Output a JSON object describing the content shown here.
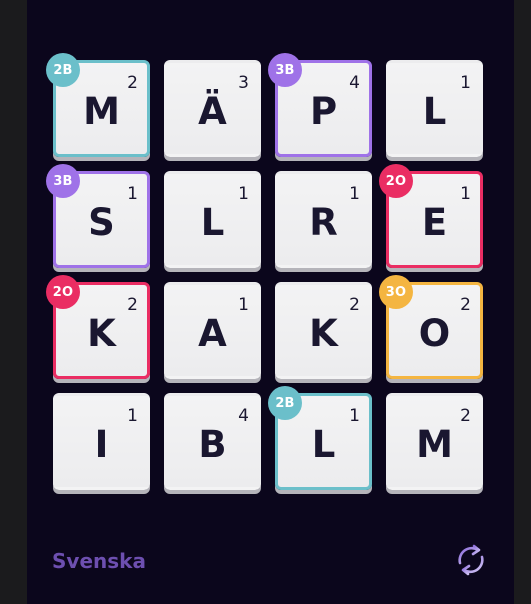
{
  "board": {
    "rows": [
      [
        {
          "letter": "M",
          "points": "2",
          "bonus": "2B"
        },
        {
          "letter": "Ä",
          "points": "3",
          "bonus": ""
        },
        {
          "letter": "P",
          "points": "4",
          "bonus": "3B"
        },
        {
          "letter": "L",
          "points": "1",
          "bonus": ""
        }
      ],
      [
        {
          "letter": "S",
          "points": "1",
          "bonus": "3B"
        },
        {
          "letter": "L",
          "points": "1",
          "bonus": ""
        },
        {
          "letter": "R",
          "points": "1",
          "bonus": ""
        },
        {
          "letter": "E",
          "points": "1",
          "bonus": "2O"
        }
      ],
      [
        {
          "letter": "K",
          "points": "2",
          "bonus": "2O"
        },
        {
          "letter": "A",
          "points": "1",
          "bonus": ""
        },
        {
          "letter": "K",
          "points": "2",
          "bonus": ""
        },
        {
          "letter": "O",
          "points": "2",
          "bonus": "3O"
        }
      ],
      [
        {
          "letter": "I",
          "points": "1",
          "bonus": ""
        },
        {
          "letter": "B",
          "points": "4",
          "bonus": ""
        },
        {
          "letter": "L",
          "points": "1",
          "bonus": "2B"
        },
        {
          "letter": "M",
          "points": "2",
          "bonus": ""
        }
      ]
    ]
  },
  "footer": {
    "language": "Svenska",
    "shuffle_icon": "shuffle-icon"
  },
  "colors": {
    "panel_bg": "#0b061c",
    "bonus_2B": "#6bbfca",
    "bonus_3B": "#9f72e8",
    "bonus_2O": "#ea2d63",
    "bonus_3O": "#f4b541",
    "language_text": "#6d4fb0"
  }
}
